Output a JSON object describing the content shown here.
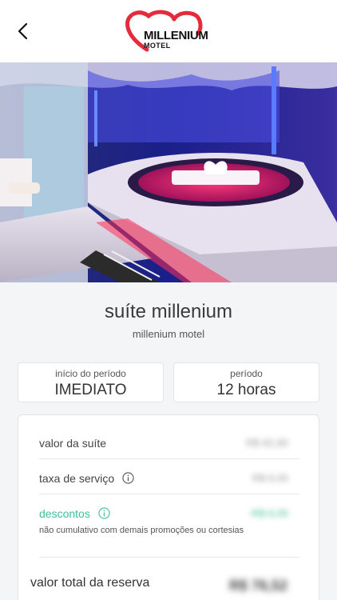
{
  "header": {
    "logo_text": "MILLENIUM",
    "logo_sub": "MOTEL",
    "back_icon": "chevron-left-icon"
  },
  "colors": {
    "accent_red": "#e32b3c",
    "discount_green": "#3fbf97",
    "page_bg": "#f4f5f7"
  },
  "carousel": {
    "total_images": 7,
    "active_index": 0
  },
  "suite": {
    "name": "suíte millenium",
    "motel": "millenium motel"
  },
  "period": {
    "start_label": "início do período",
    "start_value": "IMEDIATO",
    "length_label": "período",
    "length_value": "12 horas"
  },
  "summary": {
    "suite_value_label": "valor da suíte",
    "suite_value": "R$ 82,90",
    "service_fee_label": "taxa de serviço",
    "service_fee": "R$ 6,00",
    "discounts_label": "descontos",
    "discounts_value": "-R$ 6,00",
    "discounts_note": "não cumulativo com demais promoções ou cortesias",
    "total_label": "valor total da reserva",
    "total_value": "R$ 76,52"
  }
}
